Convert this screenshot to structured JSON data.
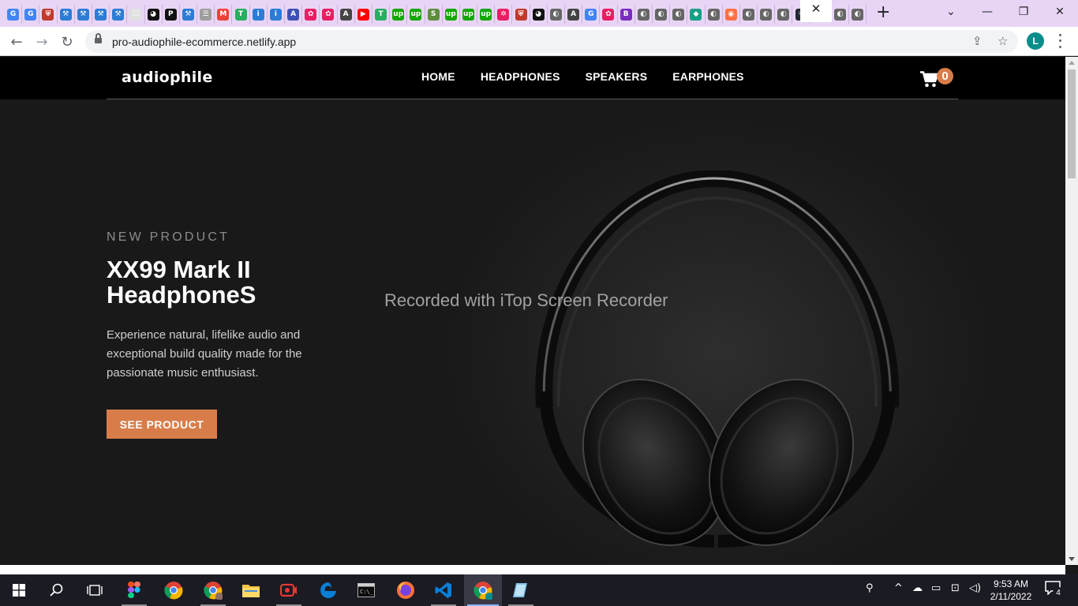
{
  "browser": {
    "tab_favicons": [
      {
        "icon": "google-g-icon",
        "color": "#4285f4",
        "glyph": "G"
      },
      {
        "icon": "google-g-icon",
        "color": "#4285f4",
        "glyph": "G"
      },
      {
        "icon": "shield-icon",
        "color": "#c0392b",
        "glyph": "⛨"
      },
      {
        "icon": "tool-icon",
        "color": "#2d7cd6",
        "glyph": "⚒"
      },
      {
        "icon": "tool-icon",
        "color": "#2d7cd6",
        "glyph": "⚒"
      },
      {
        "icon": "tool-icon",
        "color": "#2d7cd6",
        "glyph": "⚒"
      },
      {
        "icon": "tool-icon",
        "color": "#2d7cd6",
        "glyph": "⚒"
      },
      {
        "icon": "page-icon",
        "color": "#e0e0e0",
        "glyph": "☐"
      },
      {
        "icon": "github-icon",
        "color": "#111111",
        "glyph": "◕"
      },
      {
        "icon": "p-icon",
        "color": "#111111",
        "glyph": "P"
      },
      {
        "icon": "tool-icon",
        "color": "#2d7cd6",
        "glyph": "⚒"
      },
      {
        "icon": "page-icon",
        "color": "#9e9e9e",
        "glyph": "☰"
      },
      {
        "icon": "gmail-icon",
        "color": "#ea4335",
        "glyph": "M"
      },
      {
        "icon": "t-icon",
        "color": "#27ae60",
        "glyph": "T"
      },
      {
        "icon": "info-icon",
        "color": "#2d7cd6",
        "glyph": "i"
      },
      {
        "icon": "info-icon",
        "color": "#2d7cd6",
        "glyph": "i"
      },
      {
        "icon": "a-circle-icon",
        "color": "#3f51b5",
        "glyph": "A"
      },
      {
        "icon": "flower-icon",
        "color": "#e91e63",
        "glyph": "✿"
      },
      {
        "icon": "flower-icon",
        "color": "#e91e63",
        "glyph": "✿"
      },
      {
        "icon": "a-circle-icon",
        "color": "#444444",
        "glyph": "A"
      },
      {
        "icon": "youtube-icon",
        "color": "#ff0000",
        "glyph": "▶"
      },
      {
        "icon": "t-icon",
        "color": "#27ae60",
        "glyph": "T"
      },
      {
        "icon": "upwork-icon",
        "color": "#14a800",
        "glyph": "up"
      },
      {
        "icon": "upwork-icon",
        "color": "#14a800",
        "glyph": "up"
      },
      {
        "icon": "shopify-icon",
        "color": "#5e8e3e",
        "glyph": "S"
      },
      {
        "icon": "upwork-icon",
        "color": "#14a800",
        "glyph": "up"
      },
      {
        "icon": "upwork-icon",
        "color": "#14a800",
        "glyph": "up"
      },
      {
        "icon": "upwork-icon",
        "color": "#14a800",
        "glyph": "up"
      },
      {
        "icon": "gear-icon",
        "color": "#e91e63",
        "glyph": "✲"
      },
      {
        "icon": "shield-icon",
        "color": "#c0392b",
        "glyph": "⛨"
      },
      {
        "icon": "github-icon",
        "color": "#111111",
        "glyph": "◕"
      },
      {
        "icon": "globe-icon",
        "color": "#666666",
        "glyph": "◐"
      },
      {
        "icon": "a-circle-icon",
        "color": "#444444",
        "glyph": "A"
      },
      {
        "icon": "google-g-icon",
        "color": "#4285f4",
        "glyph": "G"
      },
      {
        "icon": "flower-icon",
        "color": "#e91e63",
        "glyph": "✿"
      },
      {
        "icon": "b-icon",
        "color": "#7b2cbf",
        "glyph": "B"
      },
      {
        "icon": "globe-icon",
        "color": "#666666",
        "glyph": "◐"
      },
      {
        "icon": "globe-icon",
        "color": "#666666",
        "glyph": "◐"
      },
      {
        "icon": "globe-icon",
        "color": "#666666",
        "glyph": "◐"
      },
      {
        "icon": "diamond-icon",
        "color": "#16a085",
        "glyph": "◆"
      },
      {
        "icon": "globe-icon",
        "color": "#666666",
        "glyph": "◐"
      },
      {
        "icon": "colorful-icon",
        "color": "#ff7043",
        "glyph": "◉"
      },
      {
        "icon": "globe-icon",
        "color": "#666666",
        "glyph": "◐"
      },
      {
        "icon": "globe-icon",
        "color": "#666666",
        "glyph": "◐"
      },
      {
        "icon": "globe-icon",
        "color": "#666666",
        "glyph": "◐"
      },
      {
        "icon": "react-icon",
        "color": "#222a35",
        "glyph": "⚛"
      }
    ],
    "active_tab_close": "✕",
    "after_active_favicons": [
      {
        "icon": "globe-icon",
        "color": "#666666",
        "glyph": "◐"
      },
      {
        "icon": "globe-icon",
        "color": "#666666",
        "glyph": "◐"
      }
    ],
    "new_tab": "+",
    "window_controls": {
      "dropdown": "⌄",
      "minimize": "—",
      "restore": "❐",
      "close": "✕"
    },
    "address": "pro-audiophile-ecommerce.netlify.app",
    "profile_initial": "L"
  },
  "site": {
    "logo": "audiophile",
    "nav": [
      "HOME",
      "HEADPHONES",
      "SPEAKERS",
      "EARPHONES"
    ],
    "cart_count": "0",
    "accent_color": "#d87d4a"
  },
  "hero": {
    "eyebrow": "NEW PRODUCT",
    "title": "XX99 Mark II HeadphoneS",
    "description": "Experience natural, lifelike audio and exceptional build quality made for the passionate music enthusiast.",
    "cta_label": "SEE PRODUCT"
  },
  "overlay": {
    "watermark": "Recorded with iTop Screen Recorder"
  },
  "taskbar": {
    "clock_time": "9:53 AM",
    "clock_date": "2/11/2022",
    "notification_count": "4"
  }
}
